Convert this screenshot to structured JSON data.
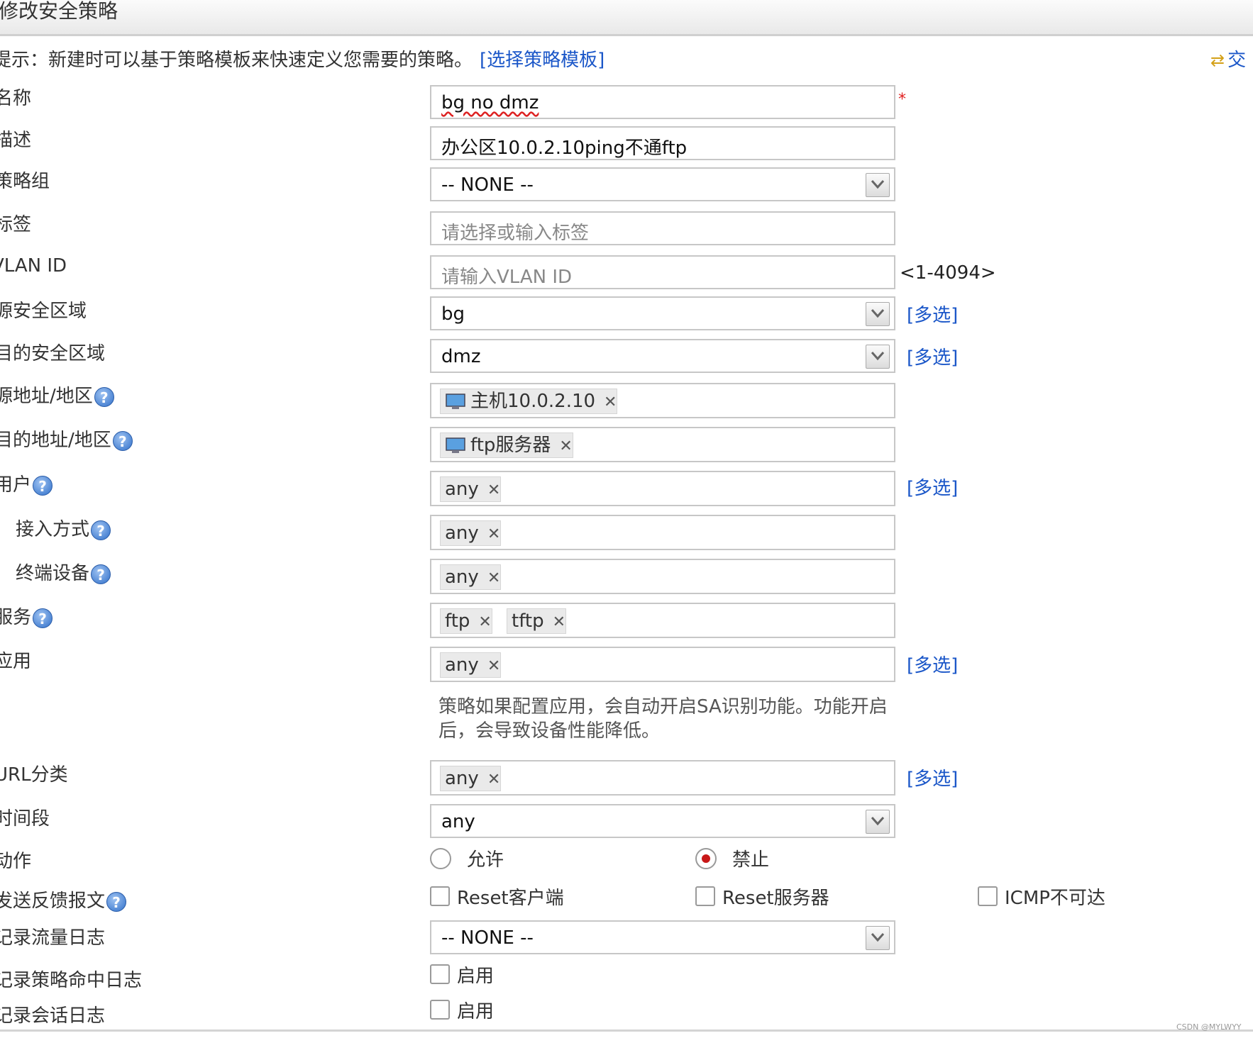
{
  "title": "修改安全策略",
  "hint": {
    "text": "提示：新建时可以基于策略模板来快速定义您需要的策略。",
    "link": "[选择策略模板]"
  },
  "topright": {
    "label": "交",
    "icon": "swap-arrows-icon"
  },
  "labels": {
    "name": "名称",
    "desc": "描述",
    "group": "策略组",
    "tag": "标签",
    "vlan": "VLAN ID",
    "src_zone": "源安全区域",
    "dst_zone": "目的安全区域",
    "src_addr": "源地址/地区",
    "dst_addr": "目的地址/地区",
    "user": "用户",
    "access": "接入方式",
    "terminal": "终端设备",
    "service": "服务",
    "app": "应用",
    "url": "URL分类",
    "time": "时间段",
    "action": "动作",
    "feedback": "发送反馈报文",
    "traffic_log": "记录流量日志",
    "hit_log": "记录策略命中日志",
    "session_log": "记录会话日志"
  },
  "fields": {
    "name": "bg no dmz",
    "desc": "办公区10.0.2.10ping不通ftp",
    "group": "-- NONE --",
    "tag_placeholder": "请选择或输入标签",
    "vlan_placeholder": "请输入VLAN ID",
    "vlan_range": "<1-4094>",
    "src_zone": "bg",
    "dst_zone": "dmz",
    "src_addr": "主机10.0.2.10",
    "dst_addr": "ftp服务器",
    "user": "any",
    "access": "any",
    "terminal": "any",
    "service_1": "ftp",
    "service_2": "tftp",
    "app": "any",
    "app_note": "策略如果配置应用，会自动开启SA识别功能。功能开启后，会导致设备性能降低。",
    "url": "any",
    "time": "any",
    "traffic_log": "-- NONE --",
    "multi": "[多选]",
    "required": "*"
  },
  "action": {
    "permit": "允许",
    "deny": "禁止",
    "selected": "deny"
  },
  "feedback": {
    "reset_client": "Reset客户端",
    "reset_server": "Reset服务器",
    "icmp": "ICMP不可达"
  },
  "enable": "启用",
  "watermark": "CSDN @MYLWYY"
}
